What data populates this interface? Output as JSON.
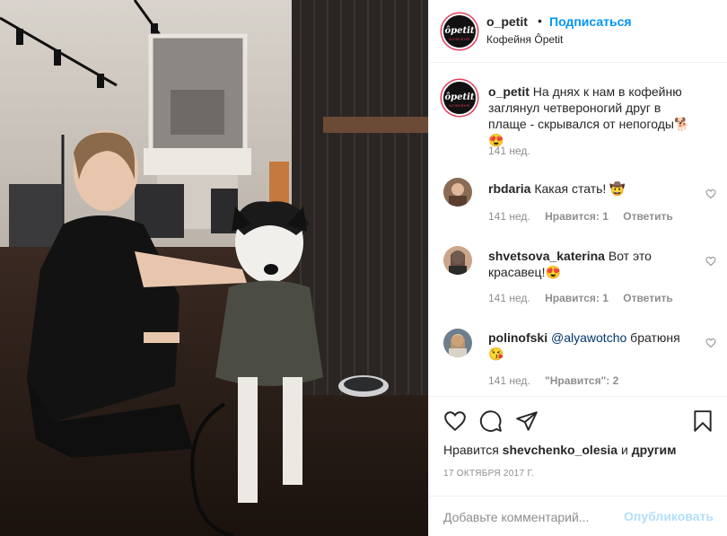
{
  "header": {
    "username": "o_petit",
    "separator": "•",
    "follow_label": "Подписаться",
    "location": "Кофейня Ôpetit",
    "logo_text": "ôpetit",
    "logo_subtext": "КОФЕЙНЯ"
  },
  "caption": {
    "username": "o_petit",
    "text": "На днях к нам в кофейню заглянул четвероногий друг в плаще - скрывался от непогоды🐕😍",
    "time": "141 нед."
  },
  "comments": [
    {
      "username": "rbdaria",
      "text": "Какая стать! 🤠",
      "time": "141 нед.",
      "likes": "Нравится: 1",
      "reply": "Ответить"
    },
    {
      "username": "shvetsova_katerina",
      "text": "Вот это красавец!😍",
      "time": "141 нед.",
      "likes": "Нравится: 1",
      "reply": "Ответить"
    },
    {
      "username": "polinofski",
      "mention": "@alyawotcho",
      "text": "братюня 😘",
      "time": "141 нед.",
      "likes": "\"Нравится\": 2"
    }
  ],
  "actions": {
    "likes_prefix": "Нравится",
    "likes_user": "shevchenko_olesia",
    "likes_joiner": "и",
    "likes_others": "другим",
    "date": "17 ОКТЯБРЯ 2017 Г."
  },
  "add_comment": {
    "placeholder": "Добавьте комментарий...",
    "publish_label": "Опубликовать"
  },
  "colors": {
    "accent": "#0095f6",
    "publish_disabled": "#b2dffc",
    "muted": "#8e8e8e",
    "text": "#262626",
    "story_ring": "#e13d5d"
  },
  "icons": [
    "heart-icon",
    "comment-icon",
    "share-icon",
    "bookmark-icon",
    "like-comment-heart-icon"
  ]
}
